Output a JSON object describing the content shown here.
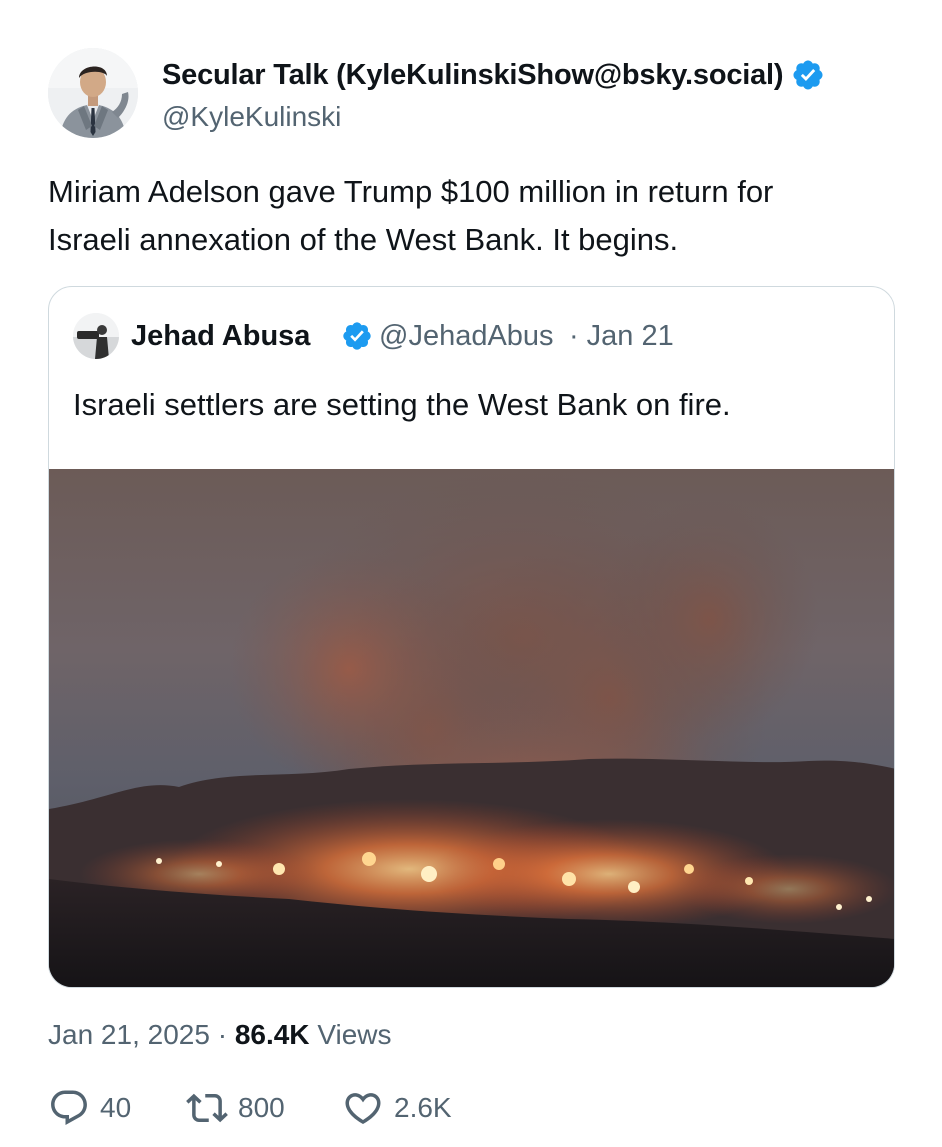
{
  "author": {
    "display_name": "Secular Talk (KyleKulinskiShow@bsky.social)",
    "handle": "@KyleKulinski",
    "verified": true
  },
  "tweet": {
    "text_line_1": "Miriam Adelson gave Trump $100 million in return for",
    "text_line_2": "Israeli annexation of the West Bank. It begins."
  },
  "quoted_tweet": {
    "display_name": "Jehad Abusa",
    "handle": "@JehadAbus",
    "separator": "·",
    "date": "Jan 21",
    "text": "Israeli settlers are setting the West Bank on fire.",
    "media": "photo-night-fire-smoke-hillside"
  },
  "meta": {
    "date": "Jan 21, 2025",
    "separator": "·",
    "views_count": "86.4K",
    "views_label": "Views"
  },
  "actions": {
    "reply_count": "40",
    "retweet_count": "800",
    "like_count": "2.6K"
  },
  "colors": {
    "verified_blue": "#1d9bf0",
    "secondary_text": "#536471",
    "primary_text": "#0f1419",
    "border": "#cfd9de"
  },
  "icons": {
    "reply": "reply-icon",
    "retweet": "retweet-icon",
    "like": "heart-icon",
    "verified": "verified-badge-icon"
  }
}
